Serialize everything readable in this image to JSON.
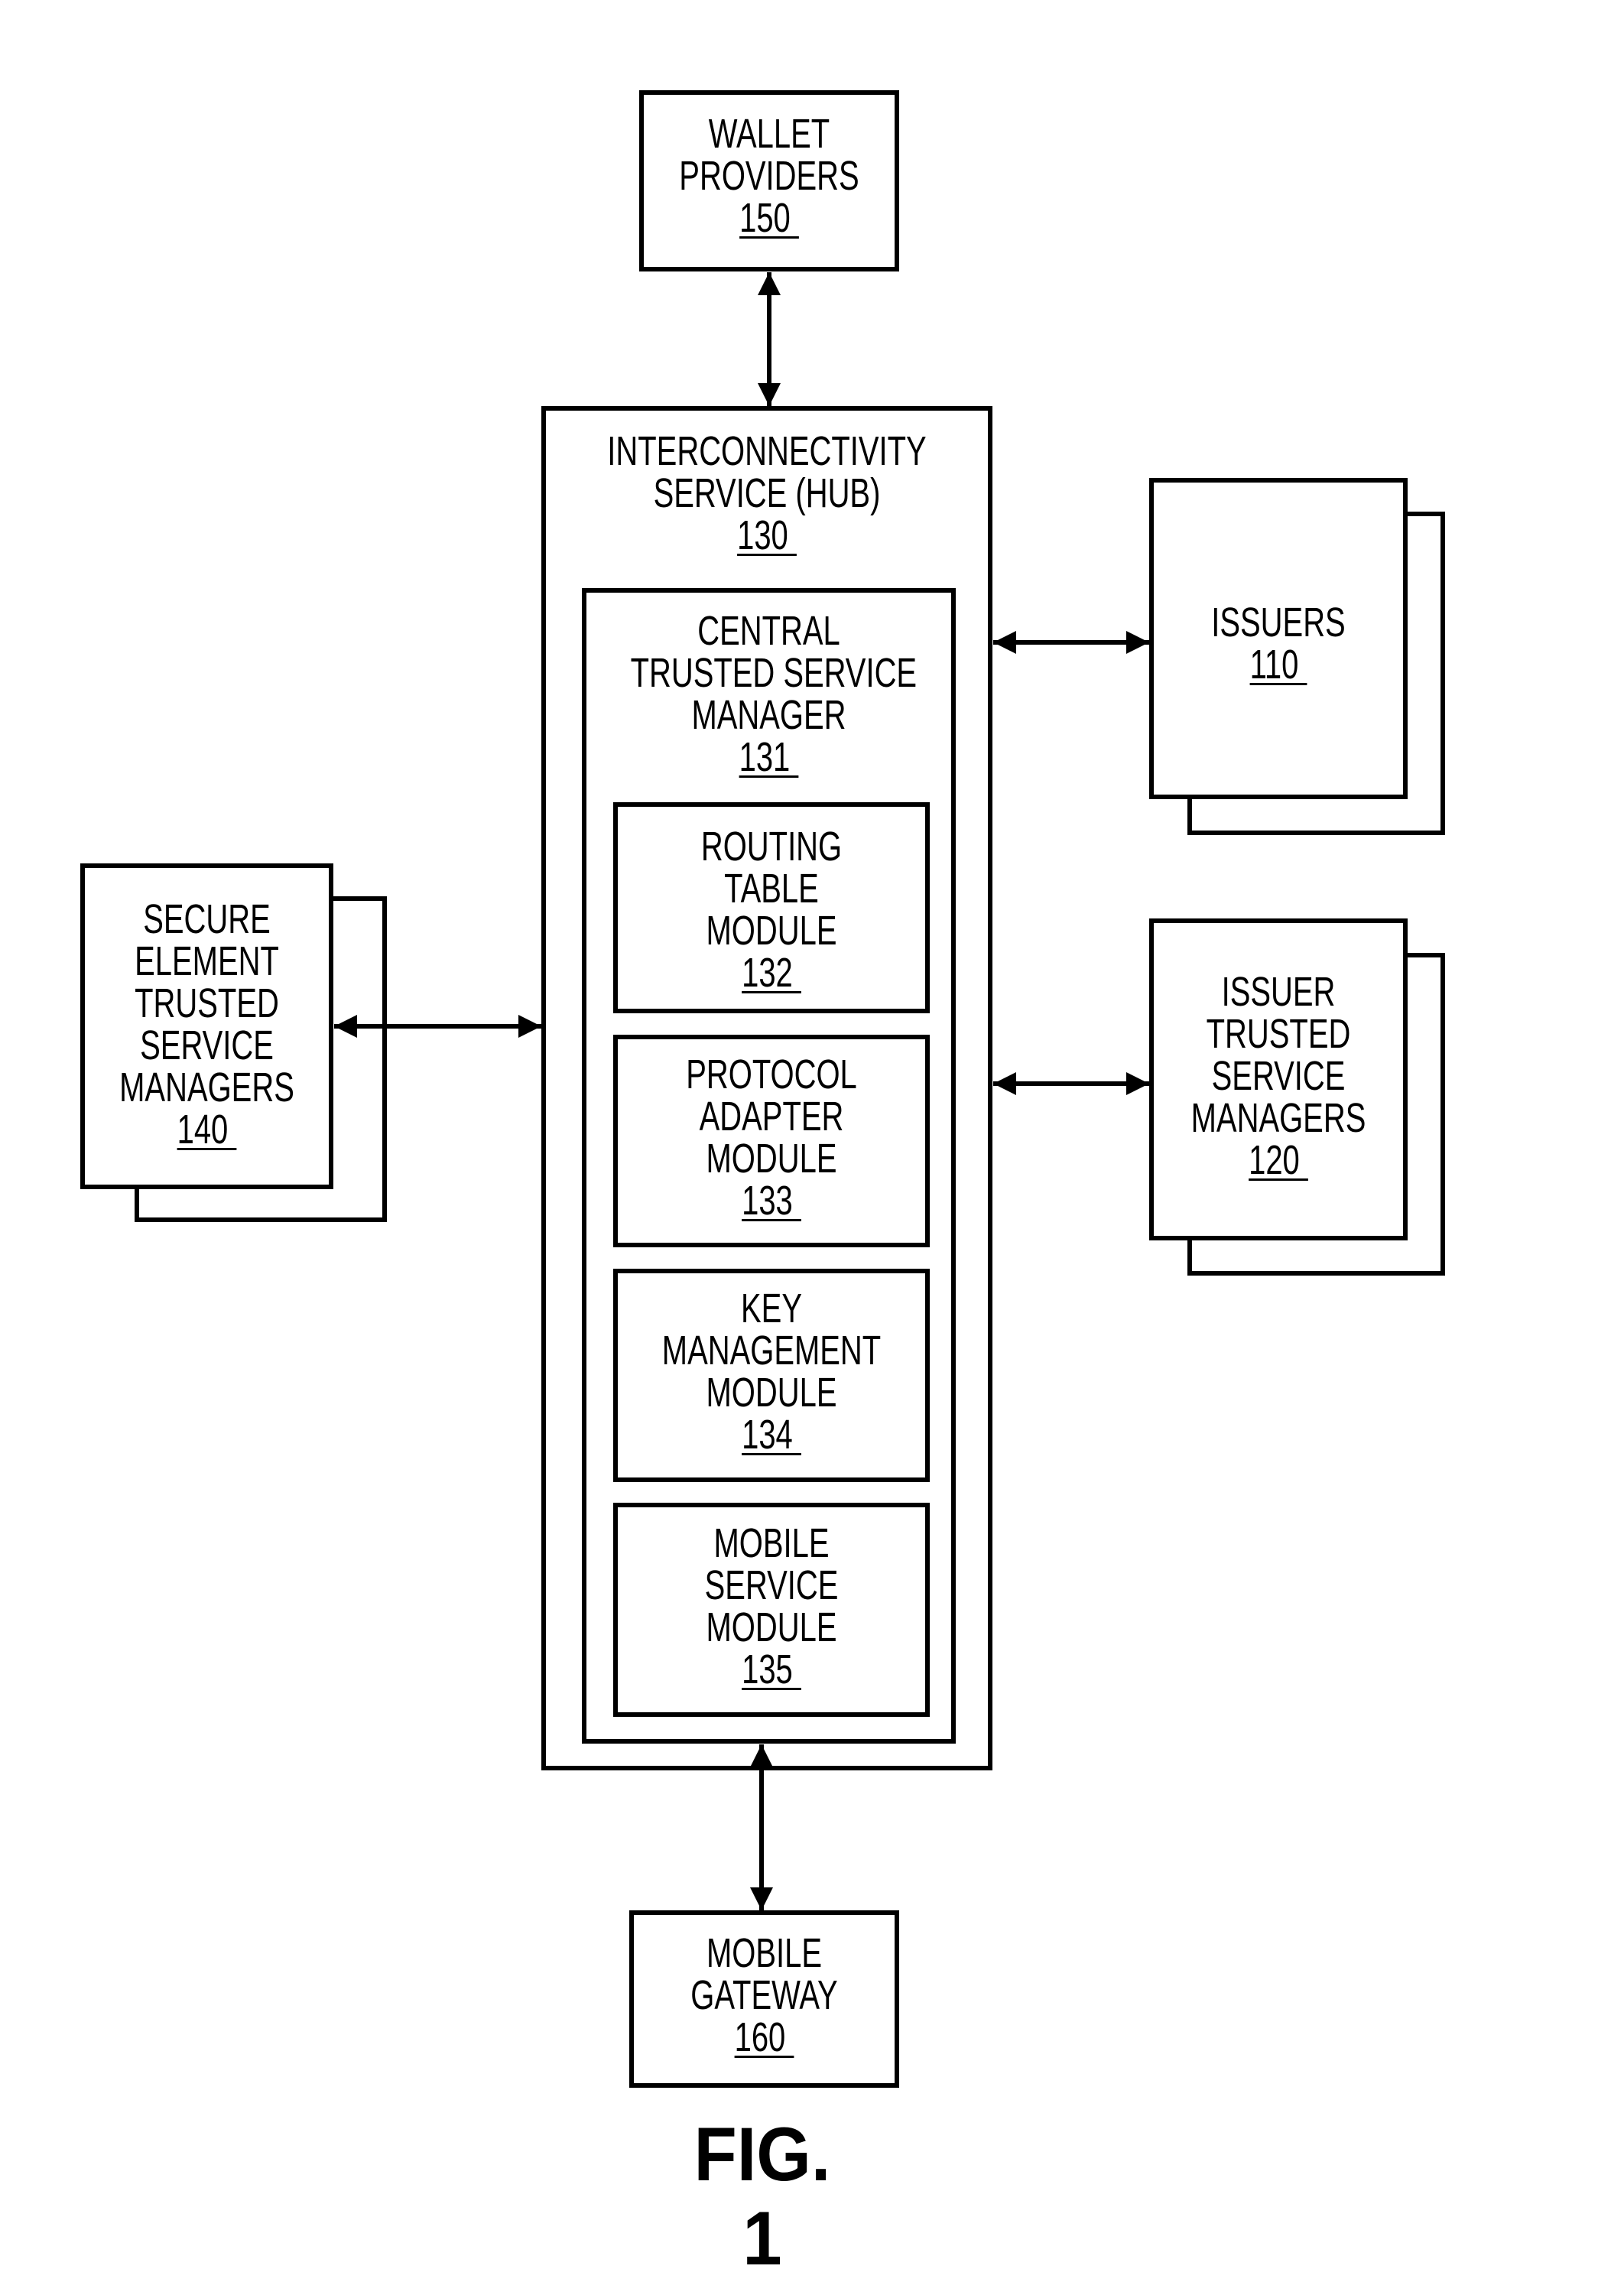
{
  "figure": {
    "caption": "FIG. 1",
    "colors": {
      "line": "#000000",
      "background": "#ffffff"
    }
  },
  "nodes": {
    "wallet": {
      "lines": [
        "WALLET",
        "PROVIDERS"
      ],
      "ref": "150 "
    },
    "hub": {
      "lines": [
        "INTERCONNECTIVITY",
        "SERVICE (HUB)"
      ],
      "ref": "130 "
    },
    "ctsm": {
      "lines": [
        "CENTRAL",
        "TRUSTED SERVICE",
        "MANAGER"
      ],
      "ref": "131 "
    },
    "routing": {
      "lines": [
        "ROUTING",
        "TABLE",
        "MODULE"
      ],
      "ref": "132 "
    },
    "protocol": {
      "lines": [
        "PROTOCOL",
        "ADAPTER",
        "MODULE"
      ],
      "ref": "133 "
    },
    "key": {
      "lines": [
        "KEY",
        "MANAGEMENT",
        "MODULE"
      ],
      "ref": "134 "
    },
    "mobile_service": {
      "lines": [
        "MOBILE",
        "SERVICE",
        "MODULE"
      ],
      "ref": "135 "
    },
    "issuers": {
      "lines": [
        "ISSUERS"
      ],
      "ref": "110 "
    },
    "issuer_tsm": {
      "lines": [
        "ISSUER",
        "TRUSTED",
        "SERVICE",
        "MANAGERS"
      ],
      "ref": "120 "
    },
    "se_tsm": {
      "lines": [
        "SECURE",
        "ELEMENT",
        "TRUSTED",
        "SERVICE",
        "MANAGERS"
      ],
      "ref": "140 "
    },
    "gateway": {
      "lines": [
        "MOBILE",
        "GATEWAY"
      ],
      "ref": "160 "
    }
  },
  "connections": [
    {
      "from": "wallet",
      "to": "hub",
      "direction": "bidirectional"
    },
    {
      "from": "hub",
      "to": "issuers",
      "direction": "bidirectional"
    },
    {
      "from": "hub",
      "to": "issuer_tsm",
      "direction": "bidirectional"
    },
    {
      "from": "se_tsm",
      "to": "hub",
      "direction": "bidirectional"
    },
    {
      "from": "ctsm",
      "to": "gateway",
      "direction": "bidirectional"
    }
  ]
}
